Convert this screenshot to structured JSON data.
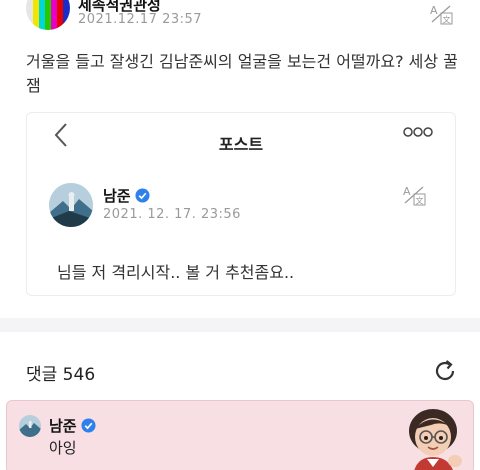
{
  "post": {
    "author": "세속적권관성",
    "date": "2021.12.17 23:57",
    "text": "거울을 들고 잘생긴 김남준씨의 얼굴을 보는건 어떨까요? 세상 꿀잼"
  },
  "quote": {
    "back_glyph": "<",
    "title": "포스트",
    "more": "ooo",
    "author": "남준",
    "date": "2021. 12. 17. 23:56",
    "text": "님들 저 격리시작.. 볼 거 추천좀요.."
  },
  "comments": {
    "header": "댓글 546",
    "items": [
      {
        "author": "남준",
        "text": "아잉"
      }
    ]
  },
  "colors": {
    "verified": "#2f80ed",
    "comment_bg": "#f7dfe3",
    "divider": "#f4f4f6"
  }
}
